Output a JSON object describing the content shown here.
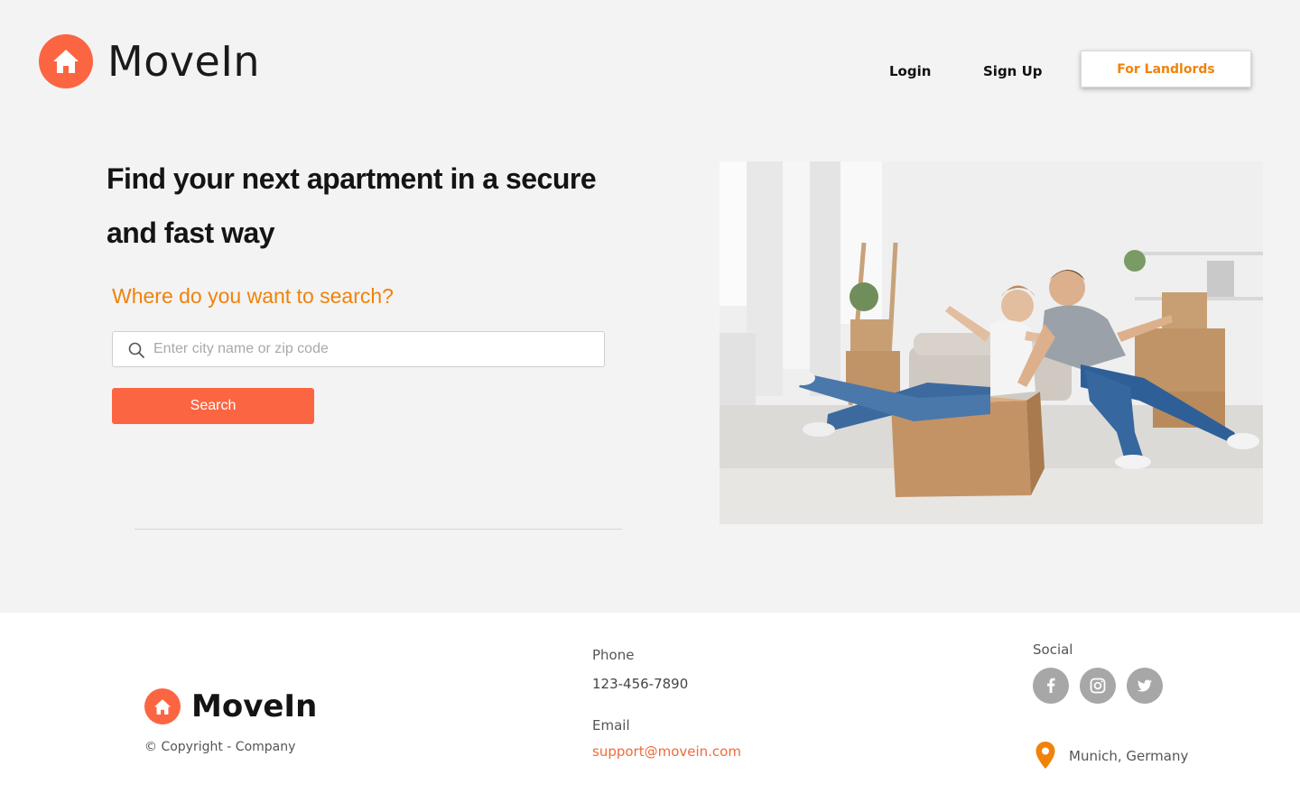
{
  "brand": {
    "name": "MoveIn",
    "accent": "#fc6541",
    "orange": "#f0820a"
  },
  "nav": {
    "login_label": "Login",
    "signup_label": "Sign Up",
    "landlords_label": "For Landlords"
  },
  "hero": {
    "title": "Find your next apartment in a secure and fast way",
    "search_heading": "Where do you want to search?",
    "search_placeholder": "Enter city name or zip code",
    "search_button": "Search"
  },
  "footer": {
    "brand_name": "MoveIn",
    "copyright": "© Copyright - Company",
    "phone_label": "Phone",
    "phone_value": "123-456-7890",
    "email_label": "Email",
    "email_value": "support@movein.com",
    "social_label": "Social",
    "social_icons": [
      "facebook-icon",
      "instagram-icon",
      "twitter-icon"
    ],
    "location": "Munich, Germany"
  }
}
